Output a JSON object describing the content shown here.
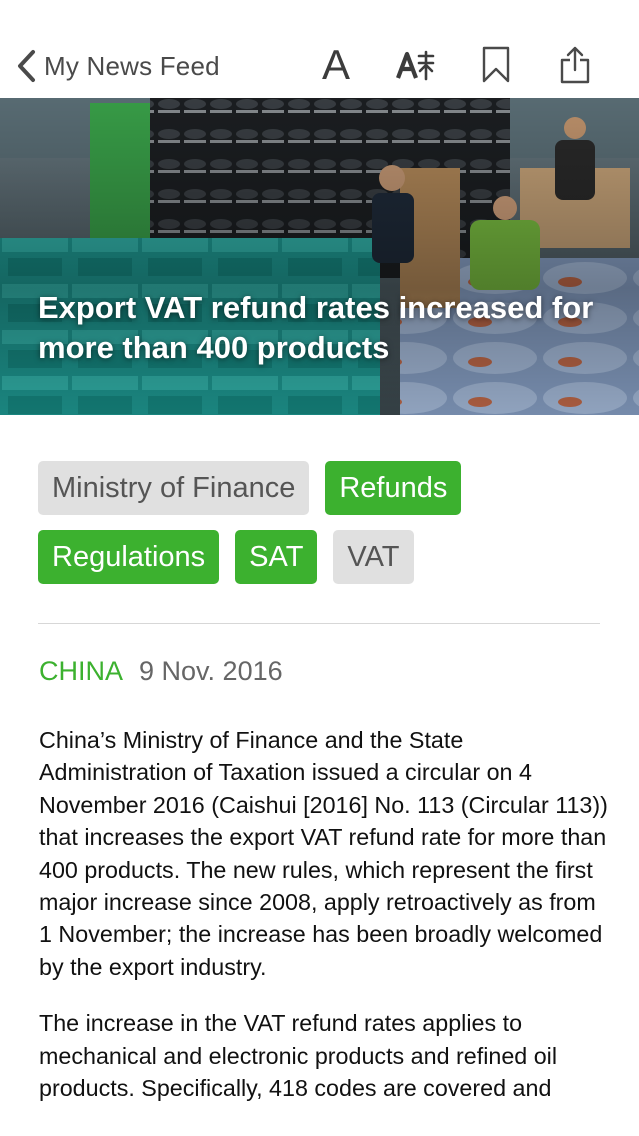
{
  "nav": {
    "back_label": "My News Feed",
    "font_size_label": "A"
  },
  "hero": {
    "title": "Export VAT refund rates increased for more than 400 products"
  },
  "tags": {
    "row1": [
      {
        "label": "Ministry of Finance",
        "style": "grey"
      },
      {
        "label": "Refunds",
        "style": "green"
      }
    ],
    "row2": [
      {
        "label": "Regulations",
        "style": "green"
      },
      {
        "label": "SAT",
        "style": "green"
      },
      {
        "label": "VAT",
        "style": "grey"
      }
    ]
  },
  "meta": {
    "region": "CHINA",
    "date": "9 Nov. 2016"
  },
  "article": {
    "paragraphs": [
      "China’s Ministry of Finance and the State Administration of Taxation issued a circular on 4 November 2016 (Caishui [2016] No. 113 (Circular 113)) that increases the export VAT refund rate for more than 400 products. The new rules, which represent the first major increase since 2008, apply retroactively as from 1 November; the increase has been broadly welcomed by the export industry.",
      "The increase in the VAT refund rates applies to mechanical and electronic products and refined oil products. Specifically, 418 codes are covered and"
    ]
  },
  "colors": {
    "accent_green": "#3cb12f",
    "tag_grey": "#e0e0e0"
  },
  "icons": [
    "chevron-left-icon",
    "font-size-icon",
    "translate-icon",
    "bookmark-icon",
    "share-icon"
  ]
}
